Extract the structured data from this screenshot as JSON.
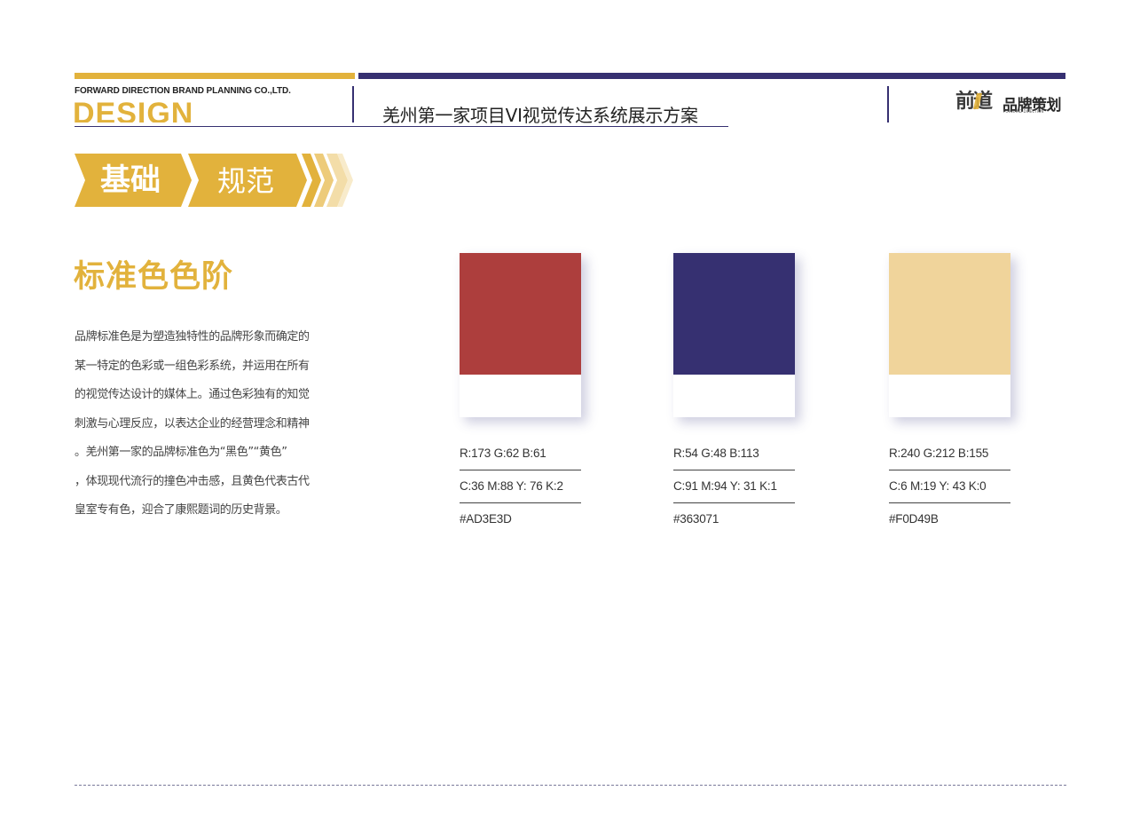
{
  "header": {
    "company": "FORWARD DIRECTION BRAND PLANNING CO.,LTD.",
    "design_word": "DESIGN",
    "project_title": "羌州第一家项目VI视觉传达系统展示方案",
    "logo": {
      "main": "前道",
      "sub": "品牌策划",
      "tag": "FORWARD DIRECTION"
    }
  },
  "banner": {
    "part1": "基础",
    "part2": "规范"
  },
  "section": {
    "title": "标准色色阶",
    "description": [
      "品牌标准色是为塑造独特性的品牌形象而确定的",
      "某一特定的色彩或一组色彩系统，并运用在所有",
      "的视觉传达设计的媒体上。通过色彩独有的知觉",
      "刺激与心理反应，以表达企业的经营理念和精神",
      "。羌州第一家的品牌标准色为“黑色”“黄色”",
      "，体现现代流行的撞色冲击感，且黄色代表古代",
      "皇室专有色，迎合了康熙题词的历史背景。"
    ]
  },
  "colors": [
    {
      "hex_color": "#AD3E3D",
      "rgb": "R:173   G:62   B:61",
      "cmyk": "C:36  M:88  Y: 76   K:2",
      "hex": "#AD3E3D"
    },
    {
      "hex_color": "#363071",
      "rgb": "R:54   G:48    B:113",
      "cmyk": "C:91   M:94  Y: 31   K:1",
      "hex": "#363071"
    },
    {
      "hex_color": "#F0D49B",
      "rgb": "R:240    G:212    B:155",
      "cmyk": "C:6     M:19  Y: 43   K:0",
      "hex": "#F0D49B"
    }
  ],
  "theme": {
    "gold": "#E2B23C",
    "navy": "#363071",
    "gold_light": "#F0D49B"
  }
}
